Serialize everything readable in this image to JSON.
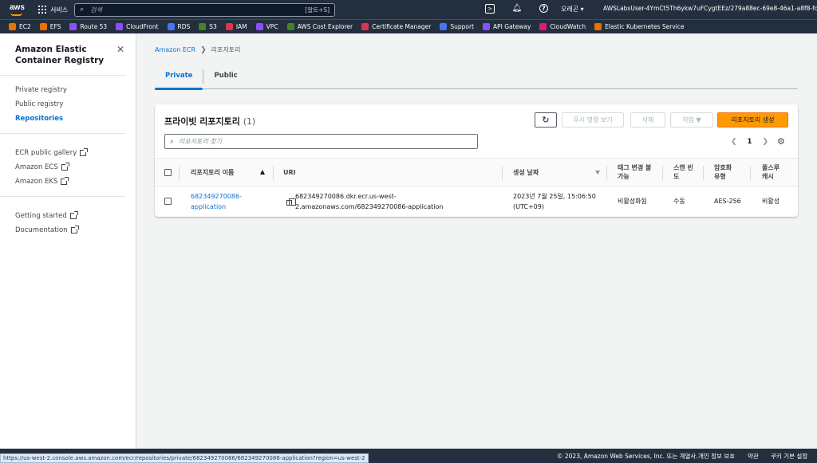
{
  "topnav": {
    "logo_text": "aws",
    "services_label": "서비스",
    "search_placeholder": "검색",
    "search_shortcut": "[알트+S]",
    "region": "오레곤 ▾",
    "account": "AWSLabsUser-4YmCt5Th6ykw7uFCygtEEz/279a88ec-69e8-46a1-a8f8-fc..."
  },
  "favorites": [
    {
      "label": "EC2",
      "color": "#ed7100"
    },
    {
      "label": "EFS",
      "color": "#ed7100"
    },
    {
      "label": "Route 53",
      "color": "#8c4fff"
    },
    {
      "label": "CloudFront",
      "color": "#8c4fff"
    },
    {
      "label": "RDS",
      "color": "#4d72f3"
    },
    {
      "label": "S3",
      "color": "#3f8624"
    },
    {
      "label": "IAM",
      "color": "#dd344c"
    },
    {
      "label": "VPC",
      "color": "#8c4fff"
    },
    {
      "label": "AWS Cost Explorer",
      "color": "#3f8624"
    },
    {
      "label": "Certificate Manager",
      "color": "#dd344c"
    },
    {
      "label": "Support",
      "color": "#4d72f3"
    },
    {
      "label": "API Gateway",
      "color": "#8c4fff"
    },
    {
      "label": "CloudWatch",
      "color": "#e7157b"
    },
    {
      "label": "Elastic Kubernetes Service",
      "color": "#ed7100"
    }
  ],
  "sidebar": {
    "title": "Amazon Elastic Container Registry",
    "nav": [
      "Private registry",
      "Public registry",
      "Repositories"
    ],
    "external": [
      "ECR public gallery",
      "Amazon ECS",
      "Amazon EKS"
    ],
    "help": [
      "Getting started",
      "Documentation"
    ]
  },
  "breadcrumb": {
    "root": "Amazon ECR",
    "current": "리포지토리"
  },
  "tabs": [
    "Private",
    "Public"
  ],
  "panel": {
    "title": "프라이빗 리포지토리",
    "count": "(1)",
    "btn_view_push": "푸시 명령 보기",
    "btn_delete": "삭제",
    "btn_actions": "작업 ▼",
    "btn_create": "리포지토리 생성",
    "filter_placeholder": "리포지토리 찾기",
    "page_number": "1"
  },
  "table": {
    "headers": {
      "name": "리포지토리 이름",
      "uri": "URI",
      "created": "생성 날짜",
      "tag_immutability": "태그 변경 불가능",
      "scan_frequency": "스캔 빈도",
      "encryption": "암호화 유형",
      "pull_through_cache": "풀스루 캐시"
    },
    "rows": [
      {
        "name": "682349270086-application",
        "uri": "682349270086.dkr.ecr.us-west-2.amazonaws.com/682349270086-application",
        "created": "2023년 7월 25일, 15:06:50 (UTC+09)",
        "tag_immutability": "비활성화됨",
        "scan_frequency": "수동",
        "encryption": "AES-256",
        "pull_through_cache": "비활성"
      }
    ]
  },
  "footer": {
    "copyright": "© 2023, Amazon Web Services, Inc. 또는 계열사.",
    "privacy": "개인 정보 보호",
    "terms": "약관",
    "cookies": "쿠키 기본 설정"
  },
  "status_url": "https://us-west-2.console.aws.amazon.com/ecr/repositories/private/682349270086/682349270086-application?region=us-west-2"
}
